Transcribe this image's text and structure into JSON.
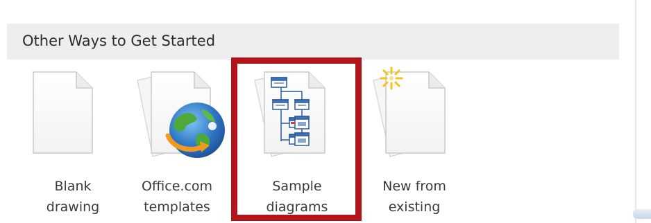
{
  "section": {
    "title": "Other Ways to Get Started"
  },
  "tiles": [
    {
      "line1": "Blank",
      "line2": "drawing",
      "icon": "blank-page-icon"
    },
    {
      "line1": "Office.com",
      "line2": "templates",
      "icon": "globe-page-icon"
    },
    {
      "line1": "Sample",
      "line2": "diagrams",
      "icon": "diagram-page-icon"
    },
    {
      "line1": "New from",
      "line2": "existing",
      "icon": "sparkle-page-icon"
    }
  ],
  "colors": {
    "highlight_border": "#b2141a",
    "header_bg": "#eeeef0"
  }
}
